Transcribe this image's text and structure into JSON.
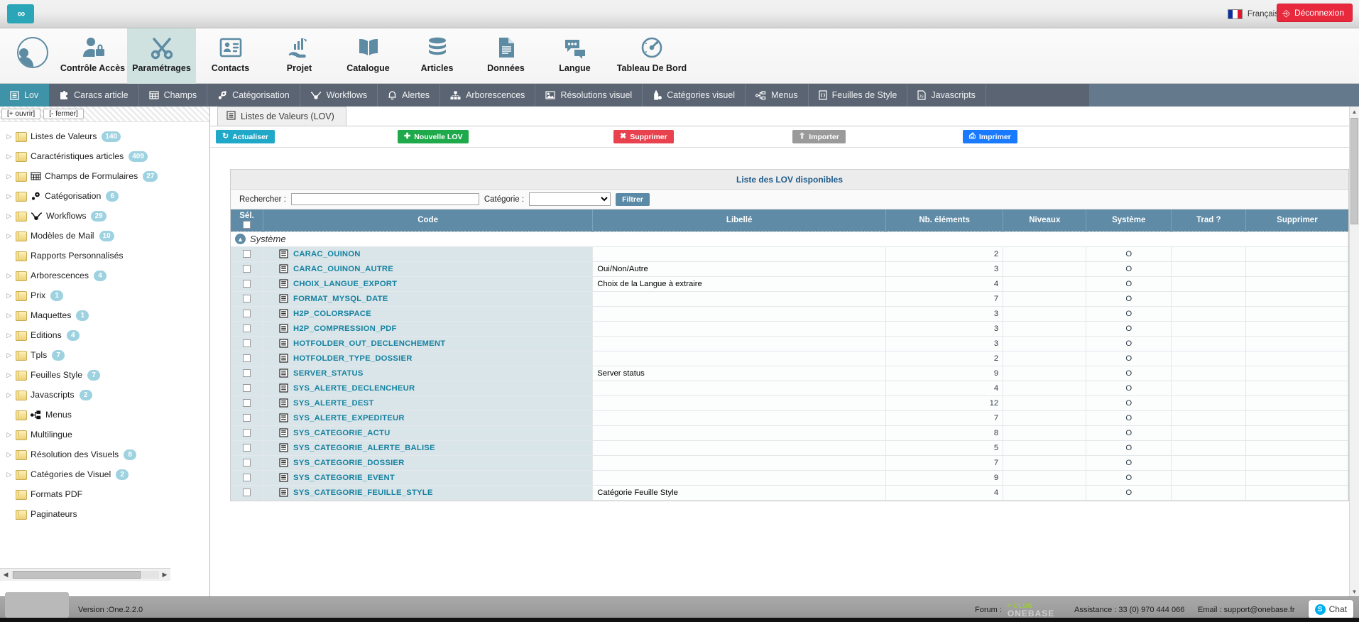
{
  "topbar": {
    "logo_icon": "glasses-logo-icon",
    "language": "Français",
    "logout_label": "Déconnexion"
  },
  "modules": [
    {
      "label": "Contrôle Accès",
      "icon": "user-lock-icon",
      "active": false
    },
    {
      "label": "Paramétrages",
      "icon": "tools-icon",
      "active": true
    },
    {
      "label": "Contacts",
      "icon": "id-card-icon",
      "active": false
    },
    {
      "label": "Projet",
      "icon": "chart-hand-icon",
      "active": false
    },
    {
      "label": "Catalogue",
      "icon": "open-book-icon",
      "active": false
    },
    {
      "label": "Articles",
      "icon": "database-icon",
      "active": false
    },
    {
      "label": "Données",
      "icon": "document-icon",
      "active": false
    },
    {
      "label": "Langue",
      "icon": "chat-bubbles-icon",
      "active": false
    },
    {
      "label": "Tableau De Bord",
      "icon": "gauge-icon",
      "active": false
    }
  ],
  "tabs": [
    {
      "label": "Lov",
      "icon": "list-icon",
      "active": true
    },
    {
      "label": "Caracs article",
      "icon": "puzzle-icon",
      "active": false
    },
    {
      "label": "Champs",
      "icon": "grid-form-icon",
      "active": false
    },
    {
      "label": "Catégorisation",
      "icon": "gear-dot-icon",
      "active": false
    },
    {
      "label": "Workflows",
      "icon": "workflow-icon",
      "active": false
    },
    {
      "label": "Alertes",
      "icon": "bell-icon",
      "active": false
    },
    {
      "label": "Arborescences",
      "icon": "hierarchy-icon",
      "active": false
    },
    {
      "label": "Résolutions visuel",
      "icon": "image-icon",
      "active": false
    },
    {
      "label": "Catégories visuel",
      "icon": "bottle-icon",
      "active": false
    },
    {
      "label": "Menus",
      "icon": "sitemap-icon",
      "active": false
    },
    {
      "label": "Feuilles de Style",
      "icon": "braces-file-icon",
      "active": false
    },
    {
      "label": "Javascripts",
      "icon": "js-file-icon",
      "active": false
    }
  ],
  "tree": {
    "open_label": "[+ ouvrir]",
    "close_label": "[- fermer]",
    "items": [
      {
        "label": "Listes de Valeurs",
        "badge": "140",
        "arrow": true,
        "subicon": ""
      },
      {
        "label": "Caractéristiques articles",
        "badge": "409",
        "arrow": true,
        "subicon": ""
      },
      {
        "label": "Champs de Formulaires",
        "badge": "27",
        "arrow": true,
        "subicon": "grid-form-icon"
      },
      {
        "label": "Catégorisation",
        "badge": "6",
        "arrow": true,
        "subicon": "gear-dot-icon"
      },
      {
        "label": "Workflows",
        "badge": "29",
        "arrow": true,
        "subicon": "workflow-icon"
      },
      {
        "label": "Modèles de Mail",
        "badge": "10",
        "arrow": true,
        "subicon": ""
      },
      {
        "label": "Rapports Personnalisés",
        "badge": "",
        "arrow": false,
        "subicon": ""
      },
      {
        "label": "Arborescences",
        "badge": "4",
        "arrow": true,
        "subicon": ""
      },
      {
        "label": "Prix",
        "badge": "1",
        "arrow": true,
        "subicon": ""
      },
      {
        "label": "Maquettes",
        "badge": "1",
        "arrow": true,
        "subicon": ""
      },
      {
        "label": "Editions",
        "badge": "4",
        "arrow": true,
        "subicon": ""
      },
      {
        "label": "Tpls",
        "badge": "7",
        "arrow": true,
        "subicon": ""
      },
      {
        "label": "Feuilles Style",
        "badge": "7",
        "arrow": true,
        "subicon": ""
      },
      {
        "label": "Javascripts",
        "badge": "2",
        "arrow": true,
        "subicon": ""
      },
      {
        "label": "Menus",
        "badge": "",
        "arrow": false,
        "subicon": "sitemap-icon"
      },
      {
        "label": "Multilingue",
        "badge": "",
        "arrow": true,
        "subicon": ""
      },
      {
        "label": "Résolution des Visuels",
        "badge": "8",
        "arrow": true,
        "subicon": ""
      },
      {
        "label": "Catégories de Visuel",
        "badge": "2",
        "arrow": true,
        "subicon": ""
      },
      {
        "label": "Formats PDF",
        "badge": "",
        "arrow": false,
        "subicon": ""
      },
      {
        "label": "Paginateurs",
        "badge": "",
        "arrow": false,
        "subicon": ""
      }
    ]
  },
  "content": {
    "tab_label": "Listes de Valeurs (LOV)",
    "tab_icon": "list-icon",
    "toolbar": {
      "refresh": "Actualiser",
      "new": "Nouvelle LOV",
      "delete": "Supprimer",
      "import": "Importer",
      "print": "Imprimer"
    },
    "panel_title": "Liste des LOV disponibles",
    "filters": {
      "search_label": "Rechercher :",
      "search_value": "",
      "search_placeholder": "",
      "category_label": "Catégorie :",
      "category_value": "",
      "filter_button": "Filtrer"
    },
    "columns": [
      "Sél.",
      "Code",
      "Libellé",
      "Nb. éléments",
      "Niveaux",
      "Système",
      "Trad ?",
      "Supprimer"
    ],
    "group_label": "Système",
    "rows": [
      {
        "code": "CARAC_OUINON",
        "libelle": "",
        "nb": "2",
        "niveaux": "",
        "systeme": "O",
        "trad": "",
        "supprimer": ""
      },
      {
        "code": "CARAC_OUINON_AUTRE",
        "libelle": "Oui/Non/Autre",
        "nb": "3",
        "niveaux": "",
        "systeme": "O",
        "trad": "",
        "supprimer": ""
      },
      {
        "code": "CHOIX_LANGUE_EXPORT",
        "libelle": "Choix de la Langue à extraire",
        "nb": "4",
        "niveaux": "",
        "systeme": "O",
        "trad": "",
        "supprimer": ""
      },
      {
        "code": "FORMAT_MYSQL_DATE",
        "libelle": "",
        "nb": "7",
        "niveaux": "",
        "systeme": "O",
        "trad": "",
        "supprimer": ""
      },
      {
        "code": "H2P_COLORSPACE",
        "libelle": "",
        "nb": "3",
        "niveaux": "",
        "systeme": "O",
        "trad": "",
        "supprimer": ""
      },
      {
        "code": "H2P_COMPRESSION_PDF",
        "libelle": "",
        "nb": "3",
        "niveaux": "",
        "systeme": "O",
        "trad": "",
        "supprimer": ""
      },
      {
        "code": "HOTFOLDER_OUT_DECLENCHEMENT",
        "libelle": "",
        "nb": "3",
        "niveaux": "",
        "systeme": "O",
        "trad": "",
        "supprimer": ""
      },
      {
        "code": "HOTFOLDER_TYPE_DOSSIER",
        "libelle": "",
        "nb": "2",
        "niveaux": "",
        "systeme": "O",
        "trad": "",
        "supprimer": ""
      },
      {
        "code": "SERVER_STATUS",
        "libelle": "Server status",
        "nb": "9",
        "niveaux": "",
        "systeme": "O",
        "trad": "",
        "supprimer": ""
      },
      {
        "code": "SYS_ALERTE_DECLENCHEUR",
        "libelle": "",
        "nb": "4",
        "niveaux": "",
        "systeme": "O",
        "trad": "",
        "supprimer": ""
      },
      {
        "code": "SYS_ALERTE_DEST",
        "libelle": "",
        "nb": "12",
        "niveaux": "",
        "systeme": "O",
        "trad": "",
        "supprimer": ""
      },
      {
        "code": "SYS_ALERTE_EXPEDITEUR",
        "libelle": "",
        "nb": "7",
        "niveaux": "",
        "systeme": "O",
        "trad": "",
        "supprimer": ""
      },
      {
        "code": "SYS_CATEGORIE_ACTU",
        "libelle": "",
        "nb": "8",
        "niveaux": "",
        "systeme": "O",
        "trad": "",
        "supprimer": ""
      },
      {
        "code": "SYS_CATEGORIE_ALERTE_BALISE",
        "libelle": "",
        "nb": "5",
        "niveaux": "",
        "systeme": "O",
        "trad": "",
        "supprimer": ""
      },
      {
        "code": "SYS_CATEGORIE_DOSSIER",
        "libelle": "",
        "nb": "7",
        "niveaux": "",
        "systeme": "O",
        "trad": "",
        "supprimer": ""
      },
      {
        "code": "SYS_CATEGORIE_EVENT",
        "libelle": "",
        "nb": "9",
        "niveaux": "",
        "systeme": "O",
        "trad": "",
        "supprimer": ""
      },
      {
        "code": "SYS_CATEGORIE_FEUILLE_STYLE",
        "libelle": "Catégorie Feuille Style",
        "nb": "4",
        "niveaux": "",
        "systeme": "O",
        "trad": "",
        "supprimer": ""
      }
    ]
  },
  "statusbar": {
    "version": "Version :One.2.2.0",
    "forum_label": "Forum :",
    "club_top": "> CLUB",
    "club_bottom": "ONEBASE",
    "assistance": "Assistance : 33 (0) 970 444 066",
    "email": "Email : support@onebase.fr",
    "chat_label": "Chat"
  },
  "colors": {
    "brand_teal": "#3f93a8",
    "nav_slate": "#5b6472",
    "table_header": "#5f8ba6",
    "link_blue": "#1682a0",
    "danger_red": "#e8283c",
    "success_green": "#1eaa4b",
    "print_blue": "#1a7aff"
  }
}
